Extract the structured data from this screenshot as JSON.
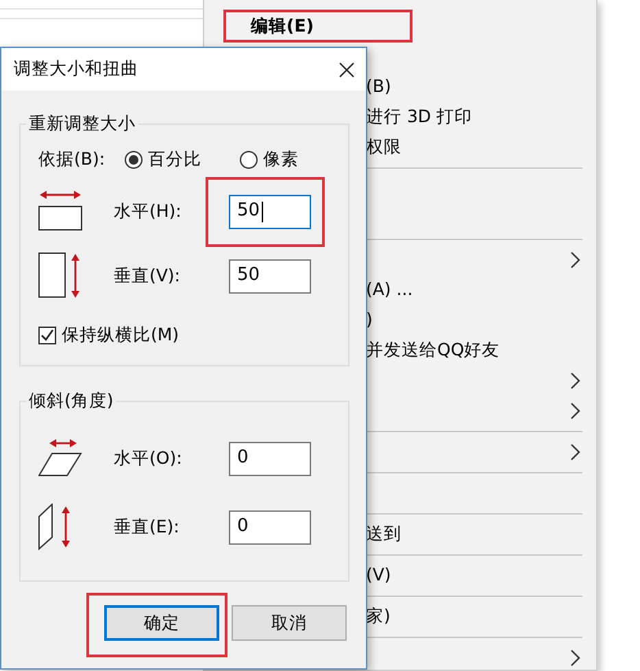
{
  "menu": {
    "items": [
      {
        "kind": "item",
        "label": "编辑(E)",
        "bold": true,
        "highlighted": true
      },
      {
        "kind": "covered"
      },
      {
        "kind": "item",
        "label": "(B)"
      },
      {
        "kind": "item",
        "label": "进行 3D 打印"
      },
      {
        "kind": "item",
        "label": "权限"
      },
      {
        "kind": "separator"
      },
      {
        "kind": "covered"
      },
      {
        "kind": "covered"
      },
      {
        "kind": "separator"
      },
      {
        "kind": "item",
        "submenu": true
      },
      {
        "kind": "item",
        "label": "(A) ..."
      },
      {
        "kind": "item",
        "label": ")"
      },
      {
        "kind": "item",
        "label": "并发送给QQ好友"
      },
      {
        "kind": "item",
        "submenu": true
      },
      {
        "kind": "item",
        "submenu": true
      },
      {
        "kind": "separator"
      },
      {
        "kind": "item",
        "submenu": true
      },
      {
        "kind": "separator"
      },
      {
        "kind": "covered"
      },
      {
        "kind": "separator"
      },
      {
        "kind": "item",
        "label": "送到"
      },
      {
        "kind": "separator"
      },
      {
        "kind": "item",
        "label": "(V)"
      },
      {
        "kind": "separator"
      },
      {
        "kind": "item",
        "label": "家)"
      },
      {
        "kind": "separator"
      },
      {
        "kind": "item",
        "submenu": true
      }
    ]
  },
  "dialog": {
    "title": "调整大小和扭曲",
    "resize": {
      "title": "重新调整大小",
      "basis_label": "依据(B):",
      "options": [
        {
          "label": "百分比",
          "selected": true
        },
        {
          "label": "像素",
          "selected": false
        }
      ],
      "fields": [
        {
          "kind": "width",
          "label": "水平(H):",
          "value": "50",
          "focused": true,
          "highlighted": true
        },
        {
          "kind": "height",
          "label": "垂直(V):",
          "value": "50",
          "focused": false,
          "highlighted": false
        }
      ],
      "keep_ratio": {
        "label": "保持纵横比(M)",
        "checked": true
      }
    },
    "skew": {
      "title": "倾斜(角度)",
      "fields": [
        {
          "kind": "slant",
          "label": "水平(O):",
          "value": "0",
          "focused": false,
          "highlighted": false
        },
        {
          "kind": "tilt",
          "label": "垂直(E):",
          "value": "0",
          "focused": false,
          "highlighted": false
        }
      ]
    },
    "buttons": [
      {
        "label": "确定",
        "default": true,
        "highlighted": true
      },
      {
        "label": "取消",
        "default": false,
        "highlighted": false
      }
    ]
  }
}
